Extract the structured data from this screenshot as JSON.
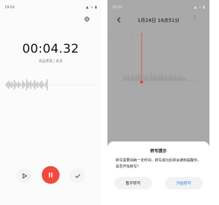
{
  "left_screen": {
    "status_time": "19:52",
    "status_icons": "▲ ∿ ▮",
    "timer": "00:04.32",
    "subtitle": "高品质录 | 高清",
    "icons": [
      "gear-icon",
      "play-icon",
      "pause-icon",
      "check-icon"
    ],
    "accent": "#f04a3e"
  },
  "right_screen": {
    "status_time": "19:52",
    "status_icons": "▲ ∿ ▮",
    "title": "1月24日 18点51分",
    "more": "⋮",
    "dialog": {
      "title": "转写提示",
      "body": "转写需要消耗一定时间，转写成功后将会通知提醒你，是否开始转写？",
      "cancel_label": "暂不转写",
      "confirm_label": "开始转写"
    },
    "accent": "#2f7de1",
    "playhead_color": "#e23b3b"
  }
}
